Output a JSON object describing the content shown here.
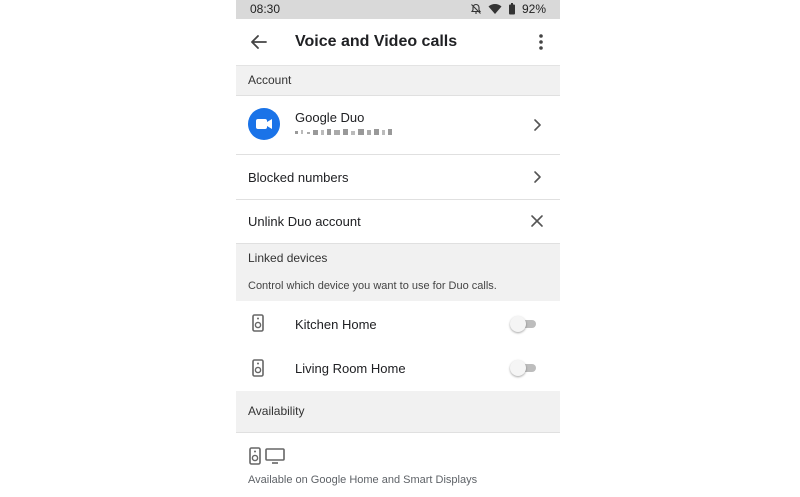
{
  "status_bar": {
    "time": "08:30",
    "battery": "92%"
  },
  "app_bar": {
    "title": "Voice and Video calls"
  },
  "account": {
    "header": "Account",
    "duo_title": "Google Duo",
    "blocked": "Blocked numbers",
    "unlink": "Unlink Duo account"
  },
  "linked_devices": {
    "header": "Linked devices",
    "description": "Control which device you want to use for Duo calls.",
    "devices": [
      {
        "name": "Kitchen Home",
        "enabled": false
      },
      {
        "name": "Living Room Home",
        "enabled": false
      }
    ]
  },
  "availability": {
    "header": "Availability",
    "text": "Available on Google Home and Smart Displays"
  },
  "colors": {
    "duo_blue": "#1a73e8",
    "toggle_off": "#bdbdbd"
  },
  "icons": [
    "back-arrow-icon",
    "more-vert-icon",
    "duo-video-icon",
    "chevron-right-icon",
    "close-icon",
    "speaker-icon",
    "display-icon",
    "wifi-icon",
    "battery-icon",
    "bell-off-icon"
  ]
}
